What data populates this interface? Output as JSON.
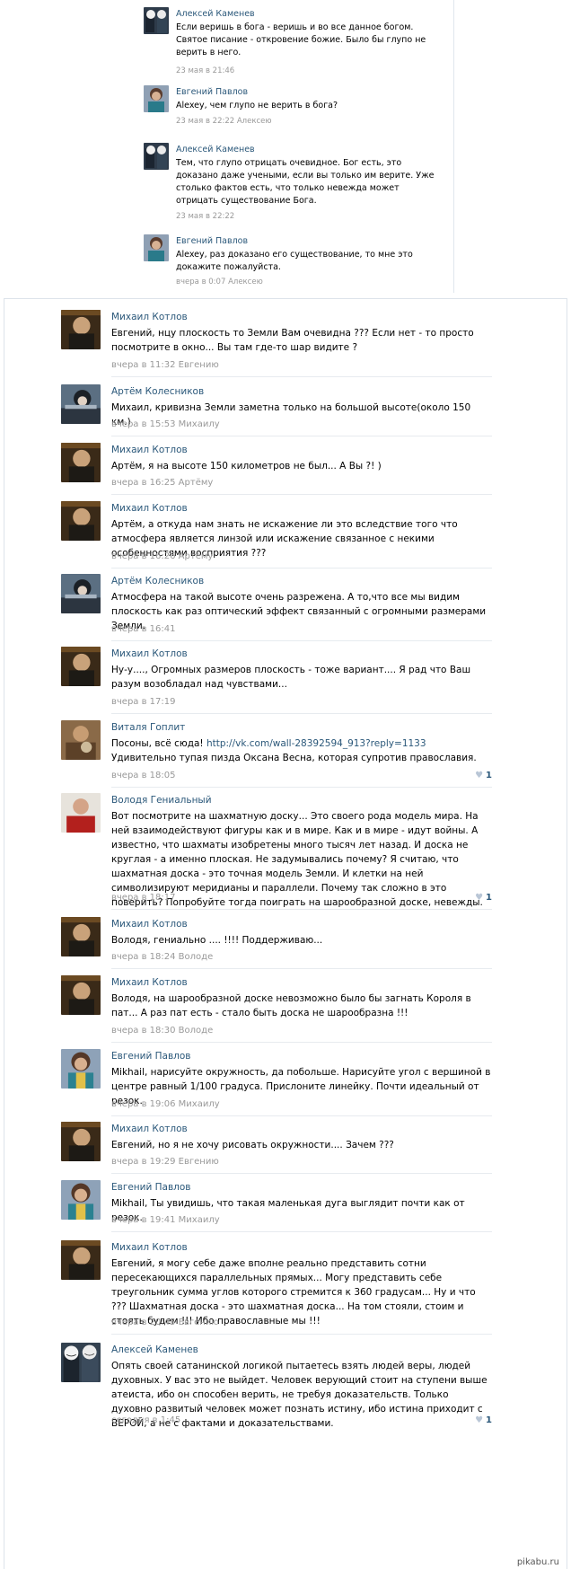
{
  "top_comments": [
    {
      "author": "Алексей Каменев",
      "text": "Если веришь в бога - веришь и во все данное богом. Святое писание - откровение божие. Было бы глупо не верить в него.",
      "meta": "23 мая в 21:46",
      "avatar": "troll-face-avatar"
    },
    {
      "author": "Евгений Павлов",
      "text": "Alexey, чем глупо не верить в бога?",
      "meta": "23 мая в 22:22 Алексею",
      "avatar": "woman-photo-avatar"
    },
    {
      "author": "Алексей Каменев",
      "text": "Тем, что глупо отрицать очевидное. Бог есть, это доказано даже учеными, если вы только им верите. Уже столько фактов есть, что только невежда может отрицать существование Бога.",
      "meta": "23 мая в 22:22",
      "avatar": "troll-face-avatar"
    },
    {
      "author": "Евгений Павлов",
      "text": "Alexey, раз доказано его существование, то мне это докажите пожалуйста.",
      "meta": "вчера в 0:07 Алексею",
      "avatar": "woman-photo-avatar"
    }
  ],
  "comments": [
    {
      "author": "Михаил Котлов",
      "text": "Евгений, нцу плоскость то Земли Вам очевидна ??? Если нет - то просто посмотрите в окно... Вы там где-то шар видите ?",
      "meta": "вчера в 11:32 Евгению",
      "avatar": "man-dark-photo-avatar"
    },
    {
      "author": "Артём Колесников",
      "text": "Михаил, кривизна Земли заметна только на большой высоте(около 150 км.)",
      "meta": "вчера в 15:53 Михаилу",
      "avatar": "anime-avatar"
    },
    {
      "author": "Михаил Котлов",
      "text": "Артём, я на высоте 150 километров не был... А Вы ?! )",
      "meta": "вчера в 16:25 Артёму",
      "avatar": "man-dark-photo-avatar"
    },
    {
      "author": "Михаил Котлов",
      "text": "Артём, а откуда нам знать не искажение ли это вследствие того что атмосфера является линзой или искажение связанное с некими особенностями восприятия ???",
      "meta": "вчера в 16:26 Артёму",
      "avatar": "man-dark-photo-avatar"
    },
    {
      "author": "Артём Колесников",
      "text": "Атмосфера на такой высоте очень разрежена. А то,что все мы видим плоскость как раз оптический эффект связанный с огромными размерами Земли.",
      "meta": "вчера в 16:41",
      "avatar": "anime-avatar"
    },
    {
      "author": "Михаил Котлов",
      "text": "Ну-у...., Огромных размеров плоскость - тоже вариант.... Я рад что Ваш разум возобладал над чувствами...",
      "meta": "вчера в 17:19",
      "avatar": "man-dark-photo-avatar"
    },
    {
      "author": "Виталя Гоплит",
      "text_before": "Посоны, всё сюда! ",
      "link": "http://vk.com/wall-28392594_913?reply=1133",
      "text_after": " Удивительно тупая пизда Оксана Весна, которая супротив православия.",
      "meta": "вчера в 18:05",
      "likes": "1",
      "avatar": "man-cat-photo-avatar"
    },
    {
      "author": "Володя Гениальный",
      "text": "Вот посмотрите на шахматную доску... Это своего рода модель мира. На ней взаимодействуют фигуры как и в мире. Как и в мире - идут войны. А известно, что шахматы изобретены много тысяч лет назад. И доска не круглая - а именно плоская. Не задумывались почему? Я считаю, что шахматная доска - это точная модель Земли. И клетки на ней символизируют меридианы и параллели. Почему так сложно в это поверить? Попробуйте тогда поиграть на шарообразной доске, невежды.",
      "meta": "вчера в 18:17",
      "likes": "1",
      "avatar": "man-red-shirt-avatar"
    },
    {
      "author": "Михаил Котлов",
      "text": "Володя, гениально .... !!!! Поддерживаю...",
      "meta": "вчера в 18:24 Володе",
      "avatar": "man-dark-photo-avatar"
    },
    {
      "author": "Михаил Котлов",
      "text": "Володя, на шарообразной доске невозможно было бы загнать Короля в пат... А раз пат есть - стало быть доска не шарообразна !!!",
      "meta": "вчера в 18:30 Володе",
      "avatar": "man-dark-photo-avatar"
    },
    {
      "author": "Евгений Павлов",
      "text": "Mikhail, нарисуйте окружность, да побольше. Нарисуйте угол с вершиной в центре равный 1/100 градуса. Прислоните линейку. Почти идеальный от резок.",
      "meta": "вчера в 19:06 Михаилу",
      "avatar": "woman-photo-avatar"
    },
    {
      "author": "Михаил Котлов",
      "text": "Евгений, но я не хочу рисовать окружности.... Зачем ???",
      "meta": "вчера в 19:29 Евгению",
      "avatar": "man-dark-photo-avatar"
    },
    {
      "author": "Евгений Павлов",
      "text": "Mikhail, Ты увидишь, что такая маленькая дуга выглядит почти как от резок.",
      "meta": "вчера в 19:41 Михаилу",
      "avatar": "woman-photo-avatar"
    },
    {
      "author": "Михаил Котлов",
      "text": "Евгений, я могу себе даже вполне реально представить сотни пересекающихся параллельных прямых... Могу представить себе треугольник сумма углов которого стремится к 360 градусам... Ну и что ??? Шахматная доска - это шахматная доска... На том стояли, стоим и стоять будем !!! Ибо православные мы !!!",
      "meta": "вчера в 20:45 Евгению",
      "avatar": "man-dark-photo-avatar"
    },
    {
      "author": "Алексей Каменев",
      "text": "Опять своей сатанинской логикой пытаетесь взять людей веры, людей духовных. У вас это не выйдет. Человек верующий стоит на ступени выше атеиста, ибо он способен верить, не требуя доказательств. Только духовно развитый человек может познать истину, ибо истина приходит с ВЕРОЙ, а не с фактами и доказательствами.",
      "meta": "сегодня в 1:45",
      "likes": "1",
      "avatar": "troll-face-avatar"
    }
  ],
  "watermark": "pikabu.ru"
}
